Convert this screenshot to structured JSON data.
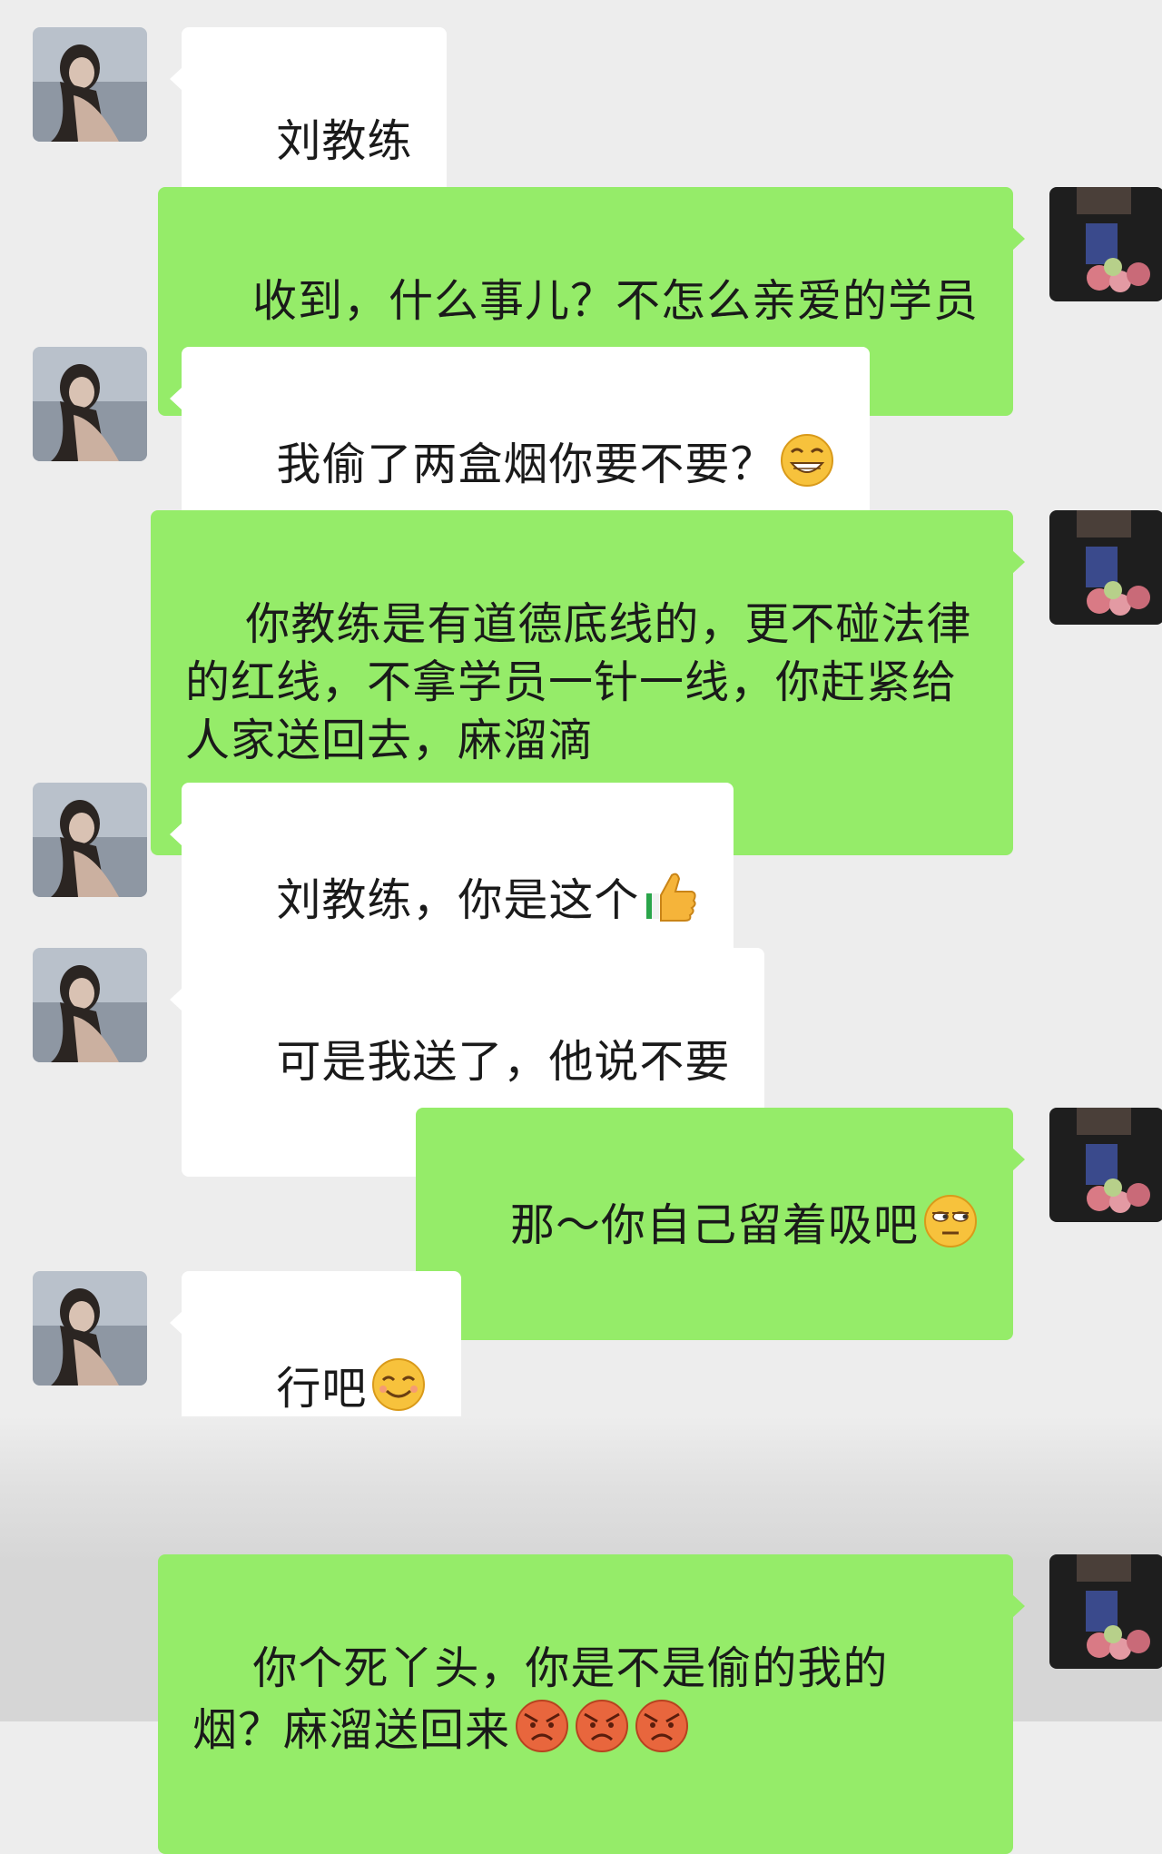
{
  "messages": [
    {
      "side": "in",
      "text": "刘教练",
      "emoji": null
    },
    {
      "side": "out",
      "text": "收到，什么事儿？不怎么亲爱的学员",
      "emoji": null
    },
    {
      "side": "in",
      "text": "我偷了两盒烟你要不要？",
      "emoji": "grin-emoji"
    },
    {
      "side": "out",
      "text": "你教练是有道德底线的，更不碰法律的红线，不拿学员一针一线，你赶紧给人家送回去，麻溜滴",
      "emoji": null
    },
    {
      "side": "in",
      "text": "刘教练，你是这个",
      "emoji": "thumbs-up-emoji"
    },
    {
      "side": "in",
      "text": "可是我送了，他说不要",
      "emoji": null
    },
    {
      "side": "out",
      "text": "那～你自己留着吸吧",
      "emoji": "side-eye-emoji"
    },
    {
      "side": "in",
      "text": "行吧",
      "emoji": "smile-emoji"
    },
    {
      "side": "out",
      "text": "你个死丫头，你是不是偷的我的烟？麻溜送回来",
      "emoji": "angry-emoji x3"
    }
  ],
  "colors": {
    "incoming_bubble": "#ffffff",
    "outgoing_bubble": "#95ec69",
    "background": "#ededed"
  }
}
